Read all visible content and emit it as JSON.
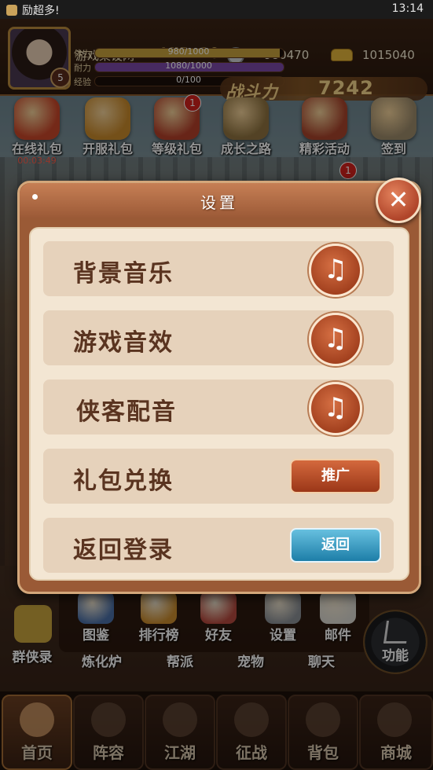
{
  "status_bar": {
    "app_name": "励超多!",
    "time": "13:14"
  },
  "player": {
    "name": "游戏架设网",
    "vip_label": "VIP",
    "vip_level": "10",
    "level": "5",
    "silver": "980470",
    "gold": "1015040",
    "stats": [
      {
        "label": "体力",
        "value": "980/1000",
        "fraction": 0.98,
        "color": "#c9a23d"
      },
      {
        "label": "耐力",
        "value": "1080/1000",
        "fraction": 1.0,
        "color": "#7a49a8"
      },
      {
        "label": "经验",
        "value": "0/100",
        "fraction": 0.0,
        "color": "#3f8b3a"
      }
    ],
    "power_label": "战斗力",
    "power": "7242"
  },
  "activities": [
    {
      "label": "在线礼包",
      "sub": "00:03:49",
      "color": "#c9472a",
      "badge": ""
    },
    {
      "label": "开服礼包",
      "sub": "",
      "color": "#c98a2c",
      "badge": ""
    },
    {
      "label": "等级礼包",
      "sub": "",
      "color": "#b4402a",
      "badge": "1"
    },
    {
      "label": "成长之路",
      "sub": "",
      "color": "#8f7340",
      "badge": ""
    },
    {
      "label": "精彩活动",
      "sub": "",
      "color": "#a8442c",
      "badge": ""
    },
    {
      "label": "签到",
      "sub": "",
      "color": "#9c8a6a",
      "badge": ""
    }
  ],
  "hidden_badge": "1",
  "functions": [
    {
      "label": "图鉴",
      "color": "#4b6fa6"
    },
    {
      "label": "排行榜",
      "color": "#c88a2d"
    },
    {
      "label": "好友",
      "color": "#b5493e"
    },
    {
      "label": "设置",
      "color": "#8a8f95"
    },
    {
      "label": "邮件",
      "color": "#d8d6cf"
    }
  ],
  "side_left": {
    "label": "群侠录"
  },
  "under_labels": [
    "炼化炉",
    "帮派",
    "宠物",
    "聊天"
  ],
  "more_button": {
    "label": "功能"
  },
  "nav": [
    {
      "label": "首页",
      "active": true
    },
    {
      "label": "阵容",
      "active": false
    },
    {
      "label": "江湖",
      "active": false
    },
    {
      "label": "征战",
      "active": false
    },
    {
      "label": "背包",
      "active": false
    },
    {
      "label": "商城",
      "active": false
    }
  ],
  "dialog": {
    "title": "设置",
    "close_glyph": "✕",
    "rows": [
      {
        "label": "背景音乐",
        "control": "music",
        "glyph": "♫"
      },
      {
        "label": "游戏音效",
        "control": "music",
        "glyph": "♫"
      },
      {
        "label": "侠客配音",
        "control": "music",
        "glyph": "♫"
      },
      {
        "label": "礼包兑换",
        "control": "button",
        "button_label": "推广",
        "button_color": "red"
      },
      {
        "label": "返回登录",
        "control": "button",
        "button_label": "返回",
        "button_color": "blue"
      }
    ]
  }
}
